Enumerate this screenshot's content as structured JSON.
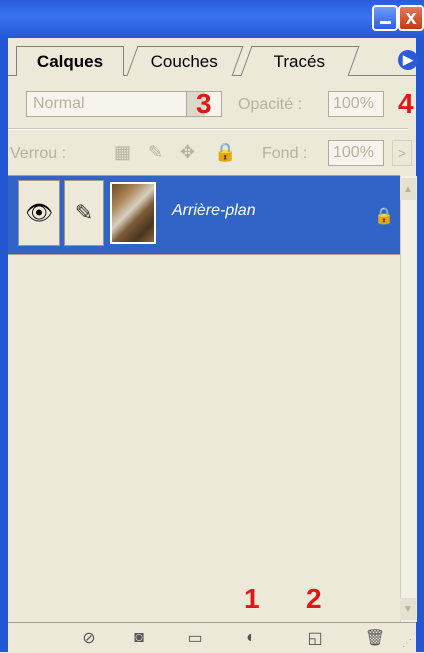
{
  "window": {
    "minimize_icon": "minimize-icon",
    "close_label": "x"
  },
  "tabs": [
    {
      "label": "Calques",
      "active": true
    },
    {
      "label": "Couches",
      "active": false
    },
    {
      "label": "Tracés",
      "active": false
    }
  ],
  "options": {
    "blend_mode": "Normal",
    "opacity_label": "Opacité :",
    "opacity_value": "100%",
    "lock_label": "Verrou :",
    "fill_label": "Fond :",
    "fill_value": "100%"
  },
  "annotations": {
    "n1": "1",
    "n2": "2",
    "n3": "3",
    "n4": "4"
  },
  "layers": [
    {
      "name": "Arrière-plan",
      "visible": true,
      "locked": true
    }
  ],
  "bottom_toolbar": [
    "link-layers-icon",
    "layer-mask-icon",
    "new-group-icon",
    "adjustment-layer-icon",
    "new-layer-icon",
    "trash-icon"
  ],
  "colors": {
    "titlebar": "#2a5cd8",
    "selected_layer": "#3264c8",
    "annotation": "#e11717",
    "panel_bg": "#ece9d8"
  }
}
